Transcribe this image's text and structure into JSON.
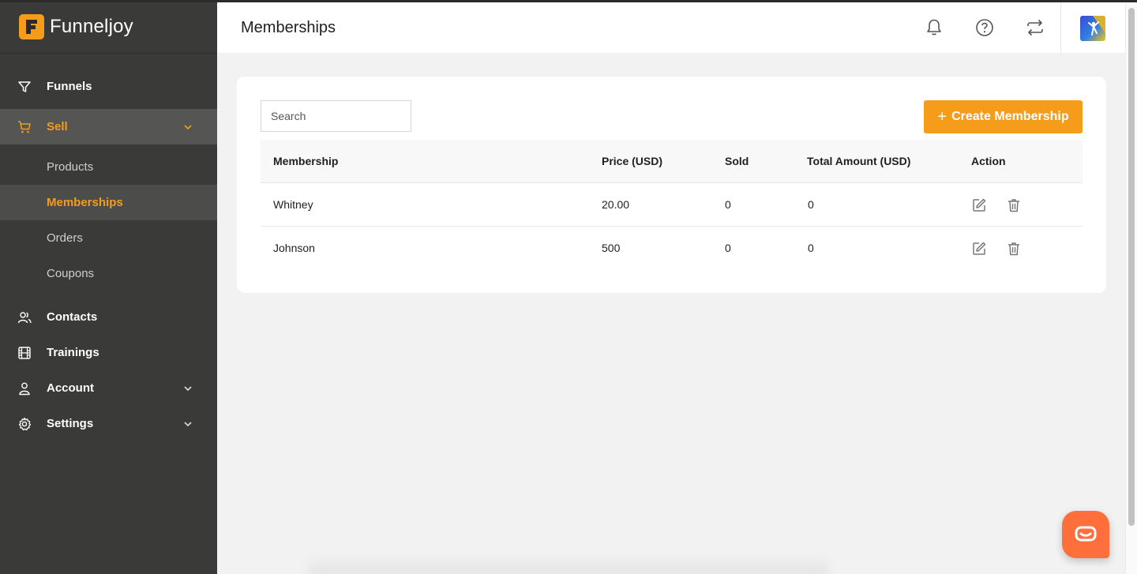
{
  "brand": {
    "letter": "F",
    "name": "Funneljoy"
  },
  "header": {
    "title": "Memberships"
  },
  "sidebar": {
    "funnels": "Funnels",
    "sell": "Sell",
    "sell_items": [
      "Products",
      "Memberships",
      "Orders",
      "Coupons"
    ],
    "contacts": "Contacts",
    "trainings": "Trainings",
    "account": "Account",
    "settings": "Settings"
  },
  "toolbar": {
    "search_placeholder": "Search",
    "create_label": "Create Membership",
    "create_icon": "+"
  },
  "table": {
    "headers": [
      "Membership",
      "Price (USD)",
      "Sold",
      "Total Amount (USD)",
      "Action"
    ],
    "rows": [
      {
        "membership": "Whitney",
        "price": "20.00",
        "sold": "0",
        "total": "0"
      },
      {
        "membership": "Johnson",
        "price": "500",
        "sold": "0",
        "total": "0"
      }
    ]
  },
  "colors": {
    "accent": "#f59c1a",
    "sidebar_bg": "#3a3a38",
    "page_bg": "#f2f2f2",
    "chat_button": "#ff6f3c"
  },
  "icons": {
    "header": [
      "bell-icon",
      "help-icon",
      "switch-icon"
    ],
    "row_actions": [
      "edit-icon",
      "trash-icon"
    ]
  }
}
